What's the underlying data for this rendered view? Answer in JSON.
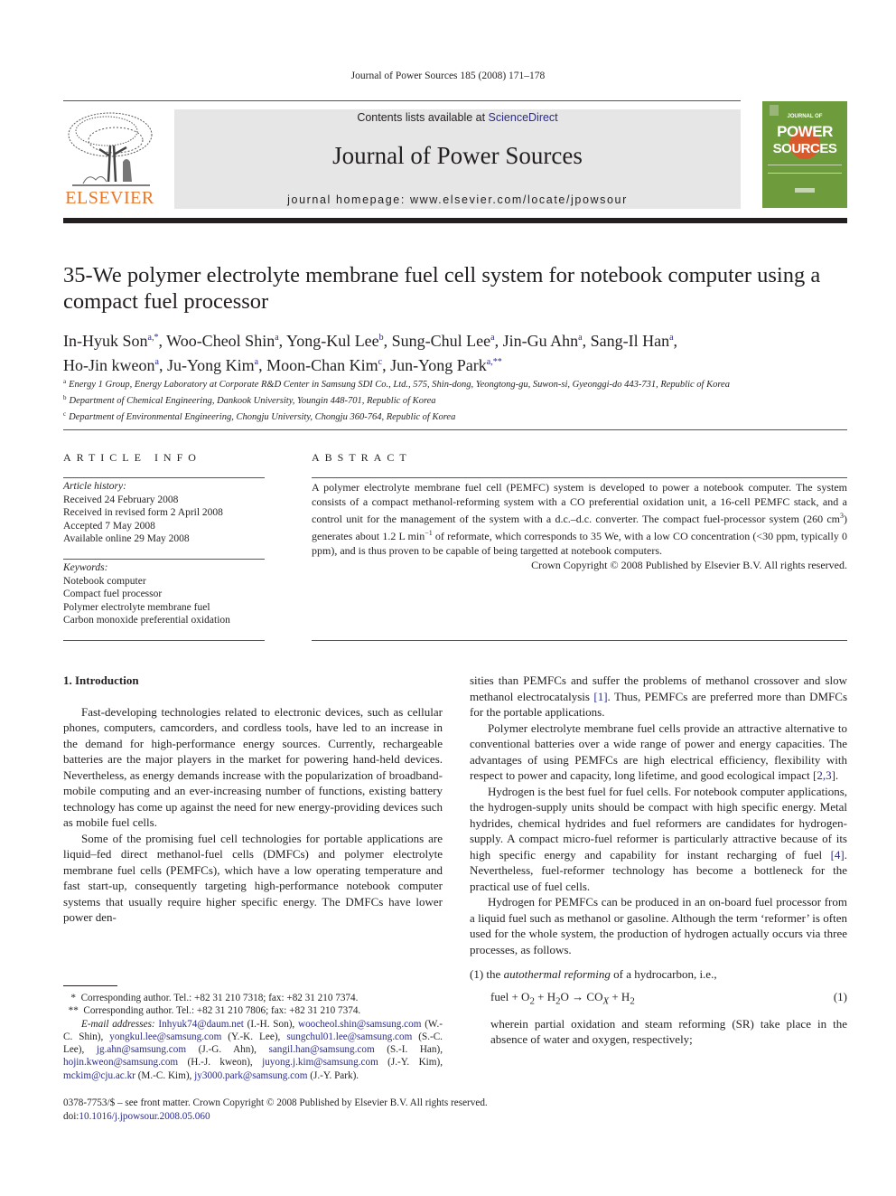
{
  "running_head": "Journal of Power Sources 185 (2008) 171–178",
  "banner": {
    "contents_prefix": "Contents lists available at ",
    "contents_link": "ScienceDirect",
    "journal_title": "Journal of Power Sources",
    "homepage": "journal homepage: www.elsevier.com/locate/jpowsour"
  },
  "publisher_logo": {
    "wordmark": "ELSEVIER",
    "color": "#e8772b"
  },
  "cover": {
    "line1": "JOURNAL OF",
    "line2": "POWER",
    "line3": "SOURCES",
    "color": "#6e9b3b"
  },
  "article": {
    "title": "35-We polymer electrolyte membrane fuel cell system for notebook computer using a compact fuel processor",
    "authors": [
      {
        "name": "In-Hyuk Son",
        "sup": "a,*",
        "sep": ", "
      },
      {
        "name": "Woo-Cheol Shin",
        "sup": "a",
        "sep": ", "
      },
      {
        "name": "Yong-Kul Lee",
        "sup": "b",
        "sep": ", "
      },
      {
        "name": "Sung-Chul Lee",
        "sup": "a",
        "sep": ", "
      },
      {
        "name": "Jin-Gu Ahn",
        "sup": "a",
        "sep": ", "
      },
      {
        "name": "Sang-Il Han",
        "sup": "a",
        "sep": ","
      },
      {
        "name": "Ho-Jin kweon",
        "sup": "a",
        "sep": ", "
      },
      {
        "name": "Ju-Yong Kim",
        "sup": "a",
        "sep": ", "
      },
      {
        "name": "Moon-Chan Kim",
        "sup": "c",
        "sep": ", "
      },
      {
        "name": "Jun-Yong Park",
        "sup": "a,**",
        "sep": ""
      }
    ],
    "affiliations": [
      {
        "key": "a",
        "text": "Energy 1 Group, Energy Laboratory at Corporate R&D Center in Samsung SDI Co., Ltd., 575, Shin-dong, Yeongtong-gu, Suwon-si, Gyeonggi-do 443-731, Republic of Korea"
      },
      {
        "key": "b",
        "text": "Department of Chemical Engineering, Dankook University, Youngin 448-701, Republic of Korea"
      },
      {
        "key": "c",
        "text": "Department of Environmental Engineering, Chongju University, Chongju 360-764, Republic of Korea"
      }
    ]
  },
  "article_info": {
    "heading": "ARTICLE INFO",
    "history_label": "Article history:",
    "history": [
      "Received 24 February 2008",
      "Received in revised form 2 April 2008",
      "Accepted 7 May 2008",
      "Available online 29 May 2008"
    ],
    "keywords_label": "Keywords:",
    "keywords": [
      "Notebook computer",
      "Compact fuel processor",
      "Polymer electrolyte membrane fuel",
      "Carbon monoxide preferential oxidation"
    ]
  },
  "abstract": {
    "heading": "ABSTRACT",
    "text_part1": "A polymer electrolyte membrane fuel cell (PEMFC) system is developed to power a notebook computer. The system consists of a compact methanol-reforming system with a CO preferential oxidation unit, a 16-cell PEMFC stack, and a control unit for the management of the system with a d.c.–d.c. converter. The compact fuel-processor system (260 cm",
    "sup1": "3",
    "text_part2": ") generates about 1.2 L min",
    "sup2": "−1",
    "text_part3": " of reformate, which corresponds to 35 We, with a low CO concentration (<30 ppm, typically 0 ppm), and is thus proven to be capable of being targetted at notebook computers.",
    "copyright": "Crown Copyright © 2008 Published by Elsevier B.V. All rights reserved."
  },
  "body": {
    "section_heading": "1.  Introduction",
    "left_paragraphs": [
      "Fast-developing technologies related to electronic devices, such as cellular phones, computers, camcorders, and cordless tools, have led to an increase in the demand for high-performance energy sources. Currently, rechargeable batteries are the major players in the market for powering hand-held devices. Nevertheless, as energy demands increase with the popularization of broadband-mobile computing and an ever-increasing number of functions, existing battery technology has come up against the need for new energy-providing devices such as mobile fuel cells.",
      "Some of the promising fuel cell technologies for portable applications are liquid–fed direct methanol-fuel cells (DMFCs) and polymer electrolyte membrane fuel cells (PEMFCs), which have a low operating temperature and fast start-up, consequently targeting high-performance notebook computer systems that usually require higher specific energy. The DMFCs have lower power den-"
    ],
    "right_p1_a": "sities than PEMFCs and suffer the problems of methanol crossover and slow methanol electrocatalysis ",
    "right_p1_ref": "[1]",
    "right_p1_b": ". Thus, PEMFCs are preferred more than DMFCs for the portable applications.",
    "right_p2_a": "Polymer electrolyte membrane fuel cells provide an attractive alternative to conventional batteries over a wide range of power and energy capacities. The advantages of using PEMFCs are high electrical efficiency, flexibility with respect to power and capacity, long lifetime, and good ecological impact ",
    "right_p2_ref": "[2,3]",
    "right_p2_b": ".",
    "right_p3_a": "Hydrogen is the best fuel for fuel cells. For notebook computer applications, the hydrogen-supply units should be compact with high specific energy. Metal hydrides, chemical hydrides and fuel reformers are candidates for hydrogen-supply. A compact micro-fuel reformer is particularly attractive because of its high specific energy and capability for instant recharging of fuel ",
    "right_p3_ref": "[4]",
    "right_p3_b": ". Nevertheless, fuel-reformer technology has become a bottleneck for the practical use of fuel cells.",
    "right_p4": "Hydrogen for PEMFCs can be produced in an on-board fuel processor from a liquid fuel such as methanol or gasoline. Although the term ‘reformer’ is often used for the whole system, the production of hydrogen actually occurs via three processes, as follows.",
    "list_item1_num": "(1) ",
    "list_item1_pre": "the ",
    "list_item1_em": "autothermal reforming",
    "list_item1_post": " of a hydrocarbon, i.e.,",
    "equation": {
      "lhs": "fuel + O",
      "o2_sub": "2",
      "plus_h": " + H",
      "h2o_sub": "2",
      "o_arrow": "O → CO",
      "cox_sub": "X",
      "plus_h2": " + H",
      "h2_sub": "2",
      "number": "(1)"
    },
    "list_item1_cont": "wherein partial oxidation and steam reforming (SR) take place in the absence of water and oxygen, respectively;"
  },
  "footnotes": {
    "fn1_mark": "*",
    "fn1": "Corresponding author. Tel.: +82 31 210 7318; fax: +82 31 210 7374.",
    "fn2_mark": "**",
    "fn2": "Corresponding author. Tel.: +82 31 210 7806; fax: +82 31 210 7374.",
    "email_label": "E-mail addresses: ",
    "emails": [
      {
        "addr": "Inhyuk74@daum.net",
        "who": " (I.-H. Son), "
      },
      {
        "addr": "woocheol.shin@samsung.com",
        "who": " (W.-C. Shin), "
      },
      {
        "addr": "yongkul.lee@samsung.com",
        "who": " (Y.-K. Lee), "
      },
      {
        "addr": "sungchul01.lee@samsung.com",
        "who": " (S.-C. Lee), "
      },
      {
        "addr": "jg.ahn@samsung.com",
        "who": " (J.-G. Ahn), "
      },
      {
        "addr": "sangil.han@samsung.com",
        "who": " (S.-I. Han), "
      },
      {
        "addr": "hojin.kweon@samsung.com",
        "who": " (H.-J. kweon), "
      },
      {
        "addr": "juyong.j.kim@samsung.com",
        "who": " (J.-Y. Kim), "
      },
      {
        "addr": "mckim@cju.ac.kr",
        "who": " (M.-C. Kim), "
      },
      {
        "addr": "jy3000.park@samsung.com",
        "who": " (J.-Y. Park)."
      }
    ]
  },
  "front_matter": {
    "issn_line": "0378-7753/$ – see front matter. Crown Copyright © 2008 Published by Elsevier B.V. All rights reserved.",
    "doi_label": "doi:",
    "doi": "10.1016/j.jpowsour.2008.05.060"
  },
  "colors": {
    "link": "#2b2b8c",
    "banner_bg": "#e6e6e6",
    "elsevier_orange": "#e8772b",
    "cover_green": "#6e9b3b"
  }
}
